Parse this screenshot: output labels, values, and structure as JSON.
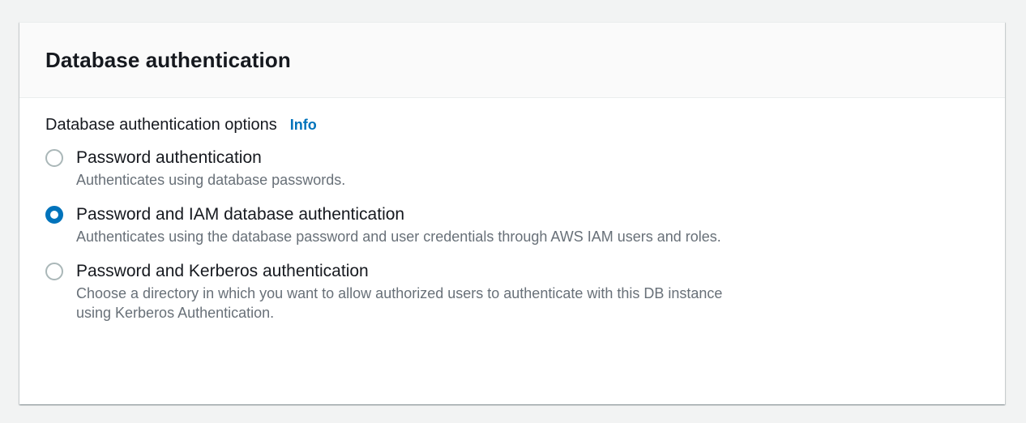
{
  "panel": {
    "title": "Database authentication",
    "field_label": "Database authentication options",
    "info_link": "Info",
    "options": [
      {
        "label": "Password authentication",
        "description": "Authenticates using database passwords.",
        "selected": false
      },
      {
        "label": "Password and IAM database authentication",
        "description": "Authenticates using the database password and user credentials through AWS IAM users and roles.",
        "selected": true
      },
      {
        "label": "Password and Kerberos authentication",
        "description": "Choose a directory in which you want to allow authorized users to authenticate with this DB instance using Kerberos Authentication.",
        "selected": false
      }
    ]
  },
  "colors": {
    "accent": "#0073bb",
    "text": "#16191f",
    "secondary_text": "#687078",
    "background": "#f2f3f3"
  }
}
